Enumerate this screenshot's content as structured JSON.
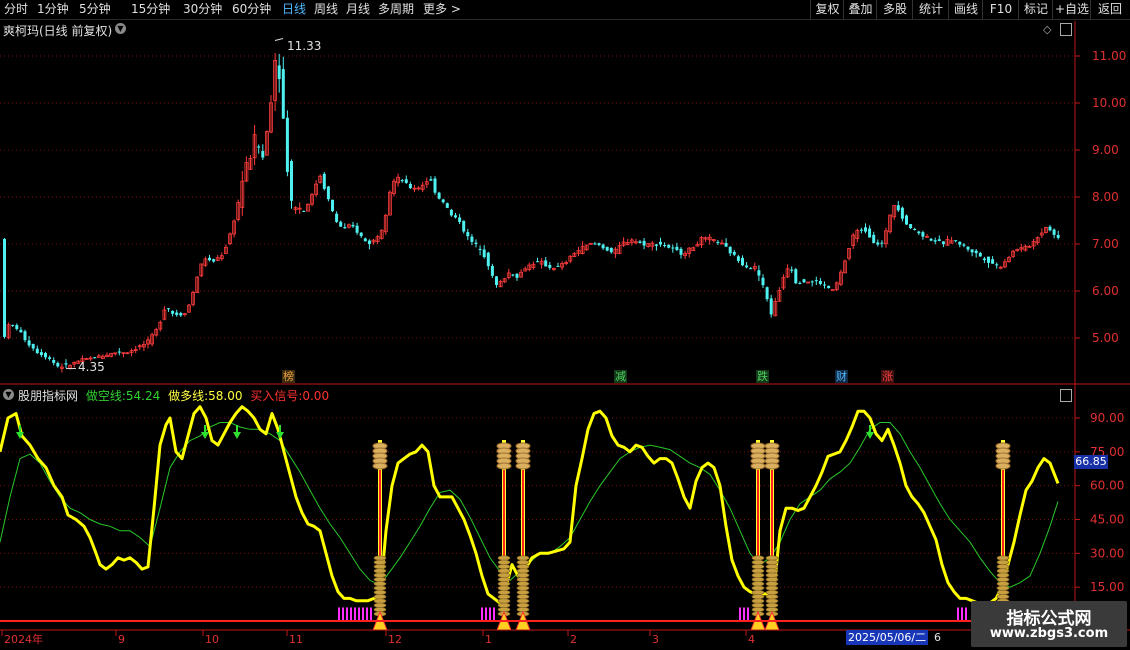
{
  "toolbar": {
    "tabs": [
      "分时",
      "1分钟",
      "5分钟",
      "15分钟",
      "30分钟",
      "60分钟",
      "日线",
      "周线",
      "月线",
      "多周期",
      "更多 >"
    ],
    "active_tab": "日线",
    "right_buttons": [
      "复权",
      "叠加",
      "多股",
      "统计",
      "画线",
      "F10",
      "标记",
      "+自选",
      "返回"
    ]
  },
  "main_panel": {
    "title": "爽柯玛(日线 前复权)",
    "price_axis": [
      "11.00",
      "10.00",
      "9.00",
      "8.00",
      "7.00",
      "6.00",
      "5.00"
    ],
    "high_label": "11.33",
    "low_label": "4.35",
    "event_tags": [
      {
        "text": "榜",
        "color": "#e8a040"
      },
      {
        "text": "减",
        "color": "#4fd060"
      },
      {
        "text": "跌",
        "color": "#4fd060"
      },
      {
        "text": "财",
        "color": "#4fb8ff"
      },
      {
        "text": "涨",
        "color": "#ff4040"
      }
    ]
  },
  "indicator_panel": {
    "name": "股朋指标网",
    "short_label": "做空线:",
    "short_value": "54.24",
    "long_label": "做多线:",
    "long_value": "58.00",
    "buy_label": "买入信号:",
    "buy_value": "0.00",
    "axis": [
      "90.00",
      "75.00",
      "60.00",
      "45.00",
      "30.00",
      "15.00"
    ],
    "current_value": "66.85"
  },
  "date_axis": {
    "labels": [
      "2024年",
      "9",
      "10",
      "11",
      "12",
      "1",
      "2",
      "3",
      "4"
    ],
    "tail_label": "6",
    "selected_date": "2025/05/06/二"
  },
  "watermark": {
    "line1": "指标公式网",
    "line2": "www.zbgs3.com"
  },
  "colors": {
    "up": "#ff3c3c",
    "down": "#4ff0f0",
    "yellow_line": "#ffff00",
    "green_line": "#28c828",
    "axis": "#c01818",
    "grid": "#7a1010",
    "magenta": "#ff30ff",
    "signal_gold": "#d9b060"
  },
  "chart_data": {
    "type": "candlestick",
    "ylim": [
      4.0,
      11.8
    ],
    "price_path": [
      [
        0,
        4.9
      ],
      [
        8,
        5.3
      ],
      [
        16,
        5.2
      ],
      [
        26,
        4.9
      ],
      [
        36,
        4.7
      ],
      [
        46,
        4.6
      ],
      [
        56,
        4.4
      ],
      [
        66,
        4.4
      ],
      [
        76,
        4.5
      ],
      [
        86,
        4.55
      ],
      [
        96,
        4.6
      ],
      [
        106,
        4.65
      ],
      [
        116,
        4.7
      ],
      [
        126,
        4.7
      ],
      [
        136,
        4.8
      ],
      [
        146,
        4.9
      ],
      [
        156,
        5.2
      ],
      [
        164,
        5.7
      ],
      [
        172,
        5.5
      ],
      [
        180,
        5.5
      ],
      [
        186,
        5.6
      ],
      [
        192,
        6.0
      ],
      [
        198,
        6.5
      ],
      [
        204,
        6.7
      ],
      [
        210,
        6.6
      ],
      [
        216,
        6.7
      ],
      [
        222,
        6.8
      ],
      [
        230,
        7.3
      ],
      [
        236,
        7.8
      ],
      [
        242,
        8.5
      ],
      [
        248,
        8.8
      ],
      [
        254,
        9.3
      ],
      [
        258,
        9.0
      ],
      [
        262,
        8.8
      ],
      [
        266,
        9.5
      ],
      [
        270,
        10.2
      ],
      [
        274,
        11.0
      ],
      [
        278,
        10.6
      ],
      [
        282,
        9.6
      ],
      [
        286,
        8.6
      ],
      [
        290,
        7.9
      ],
      [
        296,
        7.8
      ],
      [
        302,
        7.7
      ],
      [
        310,
        8.0
      ],
      [
        318,
        8.5
      ],
      [
        326,
        8.0
      ],
      [
        334,
        7.5
      ],
      [
        342,
        7.3
      ],
      [
        350,
        7.4
      ],
      [
        358,
        7.2
      ],
      [
        366,
        7.0
      ],
      [
        374,
        7.1
      ],
      [
        382,
        7.4
      ],
      [
        390,
        8.3
      ],
      [
        398,
        8.4
      ],
      [
        408,
        8.2
      ],
      [
        418,
        8.2
      ],
      [
        428,
        8.4
      ],
      [
        436,
        8.0
      ],
      [
        442,
        7.9
      ],
      [
        450,
        7.6
      ],
      [
        458,
        7.5
      ],
      [
        464,
        7.2
      ],
      [
        472,
        7.0
      ],
      [
        480,
        6.9
      ],
      [
        488,
        6.5
      ],
      [
        494,
        6.1
      ],
      [
        500,
        6.2
      ],
      [
        508,
        6.4
      ],
      [
        516,
        6.3
      ],
      [
        524,
        6.5
      ],
      [
        532,
        6.6
      ],
      [
        540,
        6.6
      ],
      [
        548,
        6.5
      ],
      [
        556,
        6.5
      ],
      [
        564,
        6.6
      ],
      [
        572,
        6.8
      ],
      [
        580,
        6.9
      ],
      [
        588,
        7.0
      ],
      [
        596,
        7.0
      ],
      [
        604,
        6.9
      ],
      [
        612,
        6.8
      ],
      [
        620,
        7.0
      ],
      [
        630,
        7.1
      ],
      [
        640,
        7.0
      ],
      [
        650,
        7.0
      ],
      [
        660,
        7.0
      ],
      [
        670,
        6.9
      ],
      [
        680,
        6.8
      ],
      [
        690,
        6.9
      ],
      [
        700,
        7.1
      ],
      [
        710,
        7.1
      ],
      [
        720,
        7.0
      ],
      [
        730,
        6.8
      ],
      [
        740,
        6.6
      ],
      [
        748,
        6.5
      ],
      [
        754,
        6.5
      ],
      [
        760,
        6.2
      ],
      [
        766,
        5.8
      ],
      [
        770,
        5.5
      ],
      [
        776,
        5.9
      ],
      [
        782,
        6.3
      ],
      [
        788,
        6.6
      ],
      [
        794,
        6.2
      ],
      [
        800,
        6.2
      ],
      [
        808,
        6.2
      ],
      [
        816,
        6.2
      ],
      [
        824,
        6.1
      ],
      [
        832,
        6.0
      ],
      [
        838,
        6.3
      ],
      [
        846,
        6.8
      ],
      [
        852,
        7.2
      ],
      [
        858,
        7.3
      ],
      [
        864,
        7.3
      ],
      [
        870,
        7.1
      ],
      [
        876,
        7.0
      ],
      [
        882,
        7.0
      ],
      [
        888,
        7.6
      ],
      [
        894,
        7.9
      ],
      [
        900,
        7.6
      ],
      [
        906,
        7.4
      ],
      [
        912,
        7.3
      ],
      [
        920,
        7.2
      ],
      [
        930,
        7.1
      ],
      [
        940,
        7.0
      ],
      [
        950,
        7.1
      ],
      [
        958,
        7.0
      ],
      [
        966,
        6.9
      ],
      [
        974,
        6.8
      ],
      [
        982,
        6.7
      ],
      [
        990,
        6.6
      ],
      [
        998,
        6.5
      ],
      [
        1006,
        6.7
      ],
      [
        1014,
        6.9
      ],
      [
        1022,
        6.9
      ],
      [
        1030,
        7.0
      ],
      [
        1038,
        7.2
      ],
      [
        1046,
        7.4
      ],
      [
        1052,
        7.2
      ],
      [
        1058,
        7.1
      ]
    ],
    "indicator_ylim": [
      0,
      100
    ],
    "yellow_path": [
      [
        0,
        75
      ],
      [
        8,
        90
      ],
      [
        16,
        92
      ],
      [
        22,
        82
      ],
      [
        30,
        78
      ],
      [
        38,
        72
      ],
      [
        46,
        68
      ],
      [
        54,
        60
      ],
      [
        62,
        55
      ],
      [
        68,
        47
      ],
      [
        76,
        45
      ],
      [
        84,
        42
      ],
      [
        90,
        37
      ],
      [
        96,
        30
      ],
      [
        100,
        25
      ],
      [
        106,
        23
      ],
      [
        112,
        25
      ],
      [
        118,
        28
      ],
      [
        124,
        27
      ],
      [
        130,
        28
      ],
      [
        136,
        26
      ],
      [
        142,
        23
      ],
      [
        148,
        24
      ],
      [
        154,
        50
      ],
      [
        160,
        78
      ],
      [
        166,
        87
      ],
      [
        170,
        90
      ],
      [
        176,
        75
      ],
      [
        182,
        72
      ],
      [
        188,
        82
      ],
      [
        194,
        92
      ],
      [
        200,
        95
      ],
      [
        206,
        90
      ],
      [
        212,
        80
      ],
      [
        218,
        78
      ],
      [
        224,
        83
      ],
      [
        230,
        88
      ],
      [
        236,
        92
      ],
      [
        242,
        95
      ],
      [
        248,
        93
      ],
      [
        254,
        90
      ],
      [
        260,
        85
      ],
      [
        266,
        83
      ],
      [
        272,
        92
      ],
      [
        278,
        85
      ],
      [
        284,
        75
      ],
      [
        290,
        65
      ],
      [
        296,
        55
      ],
      [
        302,
        48
      ],
      [
        308,
        43
      ],
      [
        314,
        42
      ],
      [
        320,
        40
      ],
      [
        326,
        30
      ],
      [
        332,
        20
      ],
      [
        338,
        13
      ],
      [
        344,
        10
      ],
      [
        350,
        10
      ],
      [
        356,
        9
      ],
      [
        362,
        9
      ],
      [
        368,
        9
      ],
      [
        374,
        10
      ],
      [
        380,
        10
      ],
      [
        386,
        40
      ],
      [
        392,
        60
      ],
      [
        398,
        70
      ],
      [
        404,
        72
      ],
      [
        410,
        74
      ],
      [
        416,
        75
      ],
      [
        422,
        78
      ],
      [
        428,
        75
      ],
      [
        434,
        60
      ],
      [
        440,
        55
      ],
      [
        446,
        55
      ],
      [
        452,
        55
      ],
      [
        458,
        50
      ],
      [
        464,
        45
      ],
      [
        470,
        38
      ],
      [
        476,
        30
      ],
      [
        482,
        20
      ],
      [
        488,
        12
      ],
      [
        494,
        10
      ],
      [
        500,
        8
      ],
      [
        506,
        15
      ],
      [
        512,
        25
      ],
      [
        518,
        20
      ],
      [
        524,
        22
      ],
      [
        532,
        28
      ],
      [
        540,
        30
      ],
      [
        548,
        30
      ],
      [
        556,
        31
      ],
      [
        564,
        32
      ],
      [
        570,
        35
      ],
      [
        576,
        60
      ],
      [
        582,
        72
      ],
      [
        588,
        85
      ],
      [
        594,
        92
      ],
      [
        600,
        93
      ],
      [
        606,
        90
      ],
      [
        612,
        82
      ],
      [
        618,
        78
      ],
      [
        624,
        77
      ],
      [
        630,
        75
      ],
      [
        636,
        78
      ],
      [
        642,
        77
      ],
      [
        648,
        73
      ],
      [
        654,
        70
      ],
      [
        660,
        72
      ],
      [
        666,
        72
      ],
      [
        672,
        70
      ],
      [
        678,
        63
      ],
      [
        684,
        55
      ],
      [
        690,
        50
      ],
      [
        696,
        62
      ],
      [
        702,
        68
      ],
      [
        708,
        70
      ],
      [
        714,
        68
      ],
      [
        720,
        60
      ],
      [
        726,
        42
      ],
      [
        732,
        27
      ],
      [
        738,
        20
      ],
      [
        744,
        15
      ],
      [
        750,
        13
      ],
      [
        756,
        12
      ],
      [
        762,
        12
      ],
      [
        768,
        12
      ],
      [
        774,
        14
      ],
      [
        780,
        40
      ],
      [
        786,
        50
      ],
      [
        792,
        50
      ],
      [
        798,
        49
      ],
      [
        804,
        50
      ],
      [
        810,
        55
      ],
      [
        816,
        60
      ],
      [
        822,
        66
      ],
      [
        828,
        73
      ],
      [
        834,
        74
      ],
      [
        840,
        75
      ],
      [
        846,
        80
      ],
      [
        852,
        86
      ],
      [
        858,
        93
      ],
      [
        864,
        93
      ],
      [
        870,
        90
      ],
      [
        876,
        83
      ],
      [
        882,
        80
      ],
      [
        888,
        85
      ],
      [
        894,
        78
      ],
      [
        900,
        70
      ],
      [
        906,
        60
      ],
      [
        912,
        55
      ],
      [
        918,
        52
      ],
      [
        924,
        48
      ],
      [
        930,
        42
      ],
      [
        936,
        36
      ],
      [
        942,
        25
      ],
      [
        948,
        17
      ],
      [
        954,
        13
      ],
      [
        960,
        10
      ],
      [
        966,
        10
      ],
      [
        972,
        9
      ],
      [
        978,
        8
      ],
      [
        984,
        8
      ],
      [
        990,
        8
      ],
      [
        996,
        10
      ],
      [
        1002,
        15
      ],
      [
        1008,
        25
      ],
      [
        1014,
        35
      ],
      [
        1020,
        47
      ],
      [
        1026,
        58
      ],
      [
        1032,
        62
      ],
      [
        1038,
        68
      ],
      [
        1044,
        72
      ],
      [
        1050,
        70
      ],
      [
        1058,
        61
      ]
    ],
    "green_path": [
      [
        0,
        35
      ],
      [
        10,
        55
      ],
      [
        20,
        72
      ],
      [
        30,
        74
      ],
      [
        40,
        70
      ],
      [
        50,
        62
      ],
      [
        60,
        55
      ],
      [
        70,
        50
      ],
      [
        80,
        48
      ],
      [
        90,
        45
      ],
      [
        100,
        43
      ],
      [
        110,
        42
      ],
      [
        120,
        40
      ],
      [
        130,
        40
      ],
      [
        140,
        37
      ],
      [
        150,
        33
      ],
      [
        160,
        50
      ],
      [
        170,
        68
      ],
      [
        180,
        75
      ],
      [
        190,
        80
      ],
      [
        200,
        82
      ],
      [
        210,
        86
      ],
      [
        220,
        88
      ],
      [
        230,
        88
      ],
      [
        240,
        86
      ],
      [
        250,
        85
      ],
      [
        260,
        85
      ],
      [
        270,
        83
      ],
      [
        280,
        80
      ],
      [
        290,
        73
      ],
      [
        300,
        66
      ],
      [
        310,
        58
      ],
      [
        320,
        50
      ],
      [
        330,
        43
      ],
      [
        340,
        37
      ],
      [
        350,
        30
      ],
      [
        360,
        23
      ],
      [
        370,
        18
      ],
      [
        380,
        16
      ],
      [
        390,
        22
      ],
      [
        400,
        28
      ],
      [
        410,
        35
      ],
      [
        420,
        42
      ],
      [
        430,
        50
      ],
      [
        440,
        57
      ],
      [
        450,
        58
      ],
      [
        460,
        54
      ],
      [
        470,
        46
      ],
      [
        480,
        37
      ],
      [
        490,
        28
      ],
      [
        500,
        22
      ],
      [
        510,
        18
      ],
      [
        520,
        22
      ],
      [
        530,
        26
      ],
      [
        540,
        30
      ],
      [
        550,
        30
      ],
      [
        560,
        33
      ],
      [
        570,
        37
      ],
      [
        580,
        45
      ],
      [
        590,
        53
      ],
      [
        600,
        60
      ],
      [
        610,
        66
      ],
      [
        620,
        72
      ],
      [
        630,
        75
      ],
      [
        640,
        77
      ],
      [
        650,
        78
      ],
      [
        660,
        77
      ],
      [
        670,
        76
      ],
      [
        680,
        73
      ],
      [
        690,
        70
      ],
      [
        700,
        68
      ],
      [
        710,
        65
      ],
      [
        720,
        58
      ],
      [
        730,
        50
      ],
      [
        740,
        40
      ],
      [
        750,
        30
      ],
      [
        760,
        25
      ],
      [
        770,
        28
      ],
      [
        780,
        35
      ],
      [
        790,
        45
      ],
      [
        800,
        52
      ],
      [
        810,
        55
      ],
      [
        820,
        58
      ],
      [
        830,
        63
      ],
      [
        840,
        66
      ],
      [
        850,
        70
      ],
      [
        860,
        77
      ],
      [
        870,
        85
      ],
      [
        880,
        88
      ],
      [
        890,
        88
      ],
      [
        900,
        83
      ],
      [
        910,
        75
      ],
      [
        920,
        68
      ],
      [
        930,
        60
      ],
      [
        940,
        52
      ],
      [
        950,
        45
      ],
      [
        960,
        40
      ],
      [
        970,
        35
      ],
      [
        980,
        28
      ],
      [
        990,
        22
      ],
      [
        1000,
        17
      ],
      [
        1010,
        15
      ],
      [
        1020,
        17
      ],
      [
        1030,
        20
      ],
      [
        1040,
        30
      ],
      [
        1050,
        42
      ],
      [
        1058,
        53
      ]
    ],
    "buy_signals_x": [
      380,
      504,
      523,
      758,
      772,
      1003
    ],
    "magenta_bars_x": [
      [
        338,
        373
      ],
      [
        481,
        496
      ],
      [
        739,
        749
      ],
      [
        957,
        965
      ]
    ]
  }
}
